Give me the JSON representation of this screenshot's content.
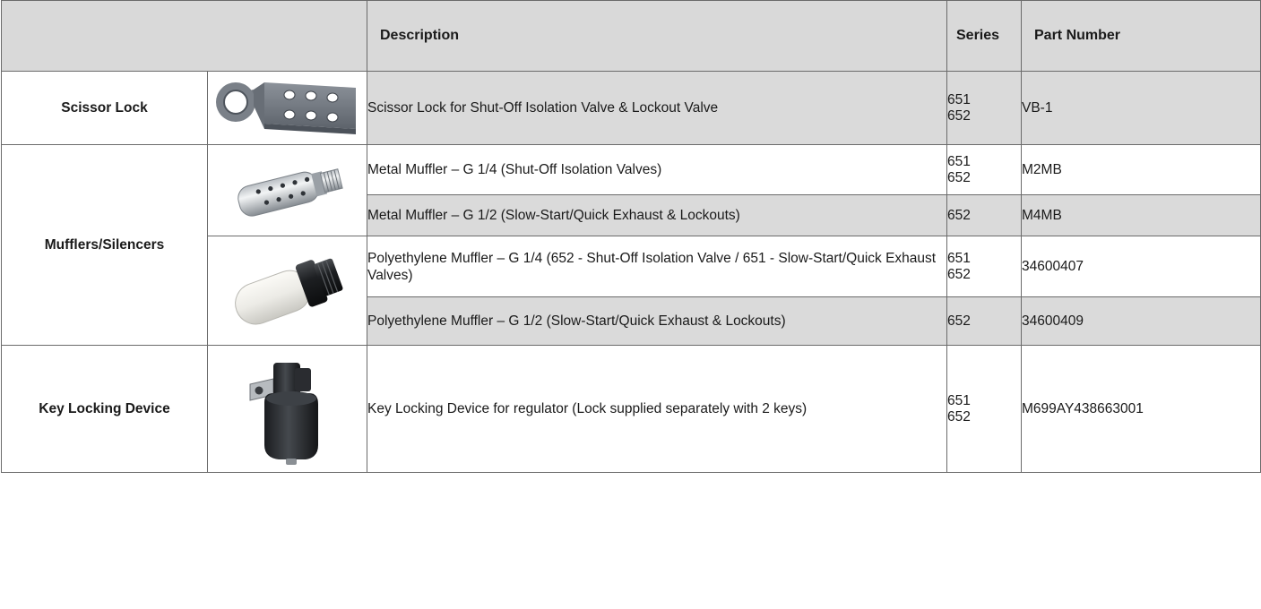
{
  "header": {
    "description": "Description",
    "series": "Series",
    "part_number": "Part Number"
  },
  "groups": [
    {
      "category": "Scissor Lock",
      "image_icon": "scissor-lock-hasp-icon"
    },
    {
      "category": "Mufflers/Silencers",
      "image_icons": [
        "metal-muffler-icon",
        "polyethylene-muffler-icon"
      ]
    },
    {
      "category": "Key Locking Device",
      "image_icon": "key-locking-device-icon"
    }
  ],
  "rows": [
    {
      "description": "Scissor Lock for Shut-Off Isolation Valve & Lockout Valve",
      "series": [
        "651",
        "652"
      ],
      "part_number": "VB-1"
    },
    {
      "description": "Metal Muffler – G 1/4 (Shut-Off Isolation Valves)",
      "series": [
        "651",
        "652"
      ],
      "part_number": "M2MB"
    },
    {
      "description": "Metal Muffler – G 1/2 (Slow-Start/Quick Exhaust & Lockouts)",
      "series": [
        "652"
      ],
      "part_number": "M4MB"
    },
    {
      "description": "Polyethylene Muffler – G 1/4 (652 - Shut-Off Isolation Valve /  651 - Slow-Start/Quick Exhaust Valves)",
      "series": [
        "651",
        "652"
      ],
      "part_number": "34600407"
    },
    {
      "description": "Polyethylene Muffler – G 1/2 (Slow-Start/Quick Exhaust & Lockouts)",
      "series": [
        "652"
      ],
      "part_number": "34600409"
    },
    {
      "description": "Key Locking Device for regulator (Lock supplied separately with 2 keys)",
      "series": [
        "651",
        "652"
      ],
      "part_number": "M699AY438663001"
    }
  ],
  "colors": {
    "header_bg": "#d9d9d9",
    "shaded_row_bg": "#dadada",
    "border": "#6b6b6b"
  }
}
